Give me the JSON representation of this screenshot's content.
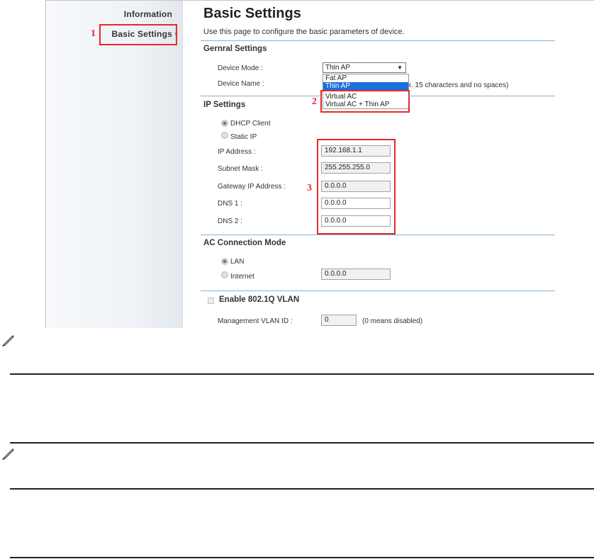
{
  "sidebar": {
    "items": [
      {
        "label": "Information"
      },
      {
        "label": "Basic Settings"
      }
    ]
  },
  "callouts": [
    "1",
    "2",
    "3"
  ],
  "page": {
    "title": "Basic Settings",
    "description": "Use this page to configure the basic parameters of device."
  },
  "general": {
    "title": "Gernral Settings",
    "device_mode_label": "Device Mode :",
    "device_mode_value": "Thin AP",
    "device_name_label": "Device Name :",
    "device_name_hint": "x. 15 characters and no spaces)",
    "options": [
      "Fat AP",
      "Thin AP",
      "Virtual AC",
      "Virtual AC + Thin AP"
    ]
  },
  "ip": {
    "title": "IP Settings",
    "dhcp_label": "DHCP Client",
    "static_label": "Static IP",
    "fields": [
      {
        "label": "IP Address :",
        "value": "192.168.1.1"
      },
      {
        "label": "Subnet Mask :",
        "value": "255.255.255.0"
      },
      {
        "label": "Gateway IP Address :",
        "value": "0.0.0.0"
      },
      {
        "label": "DNS 1 :",
        "value": "0.0.0.0"
      },
      {
        "label": "DNS 2 :",
        "value": "0.0.0.0"
      }
    ]
  },
  "ac": {
    "title": "AC Connection Mode",
    "lan_label": "LAN",
    "internet_label": "Internet",
    "internet_value": "0.0.0.0"
  },
  "vlan": {
    "title": "Enable 802.1Q VLAN",
    "mgmt_label": "Management VLAN ID :",
    "mgmt_value": "0",
    "mgmt_hint": "(0 means disabled)"
  },
  "icons": [
    "note-pencil-icon",
    "note-pencil-icon"
  ],
  "colors": {
    "callout": "#e22b2b",
    "section_line": "#7fb4d8",
    "selected_option": "#1e6fd9"
  }
}
